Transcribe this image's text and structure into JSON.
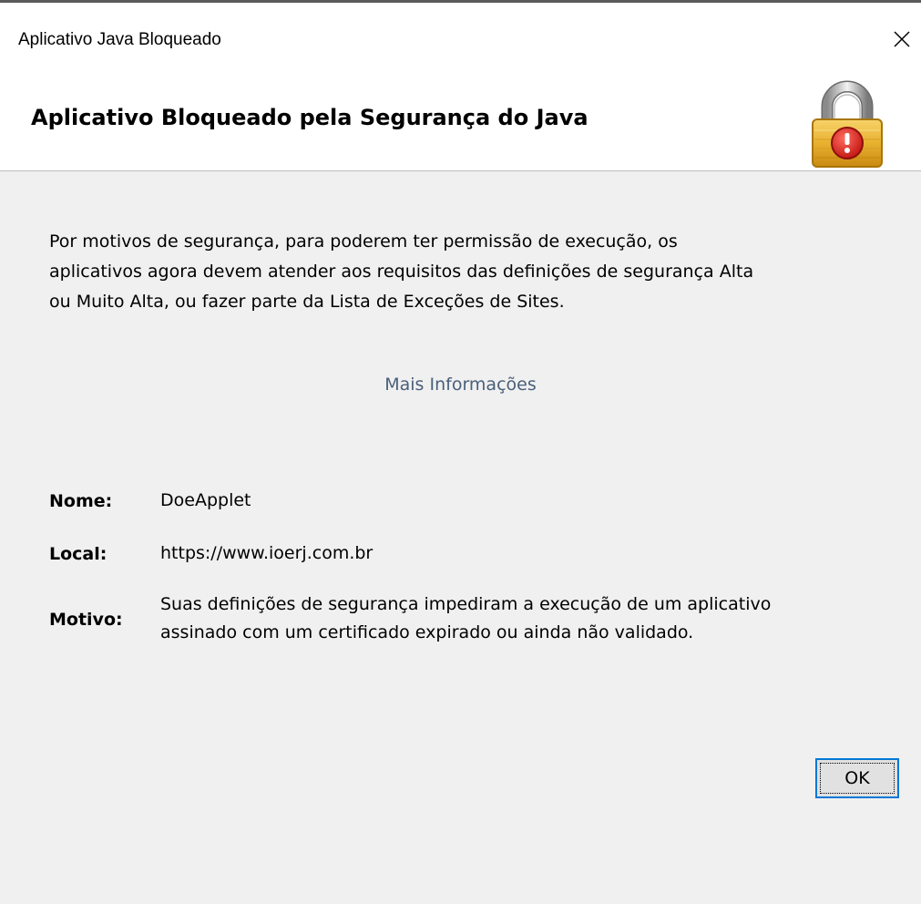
{
  "window": {
    "title": "Aplicativo Java Bloqueado",
    "close_icon": "close-icon"
  },
  "header": {
    "title": "Aplicativo Bloqueado pela Segurança do Java",
    "icon": "lock-warning-icon"
  },
  "message": {
    "line1": "Por motivos de segurança, para poderem ter permissão de execução, os",
    "line2": "aplicativos agora devem atender aos requisitos das definições de segurança Alta",
    "line3": "ou Muito Alta, ou fazer parte da Lista de Exceções de Sites."
  },
  "more_info": {
    "label": "Mais Informações"
  },
  "details": {
    "name_label": "Nome:",
    "name_value": "DoeApplet",
    "location_label": "Local:",
    "location_value": "https://www.ioerj.com.br",
    "reason_label": "Motivo:",
    "reason_line1": "Suas definições de segurança impediram a execução de um aplicativo",
    "reason_line2": "assinado com um certificado expirado ou ainda não validado."
  },
  "buttons": {
    "ok_label": "OK"
  },
  "colors": {
    "link": "#4a607a",
    "focus_border": "#0078d7",
    "lock_gold": "#e8b130",
    "alert_red": "#d9201c"
  }
}
